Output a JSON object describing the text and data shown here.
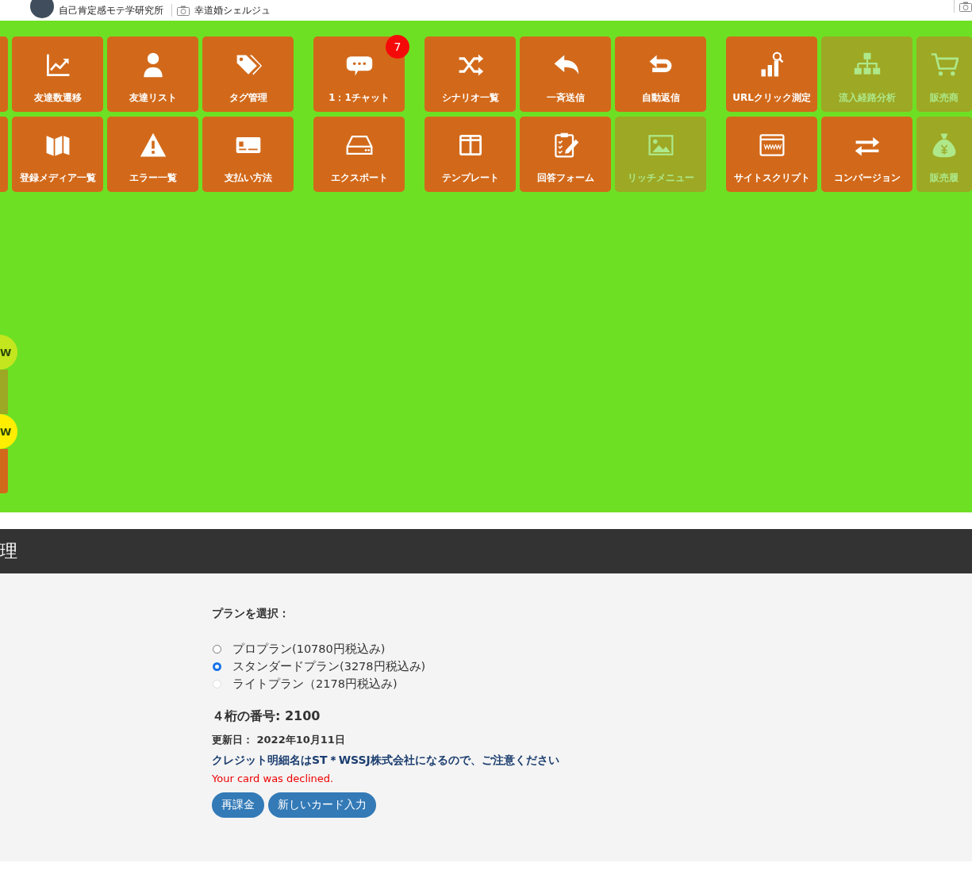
{
  "header": {
    "accounts": [
      {
        "name": "自己肯定感モテ学研究所",
        "kind": "avatar"
      },
      {
        "name": "幸道婚シェルジュ",
        "kind": "camera"
      }
    ]
  },
  "menu": {
    "groups": [
      {
        "tiles": [
          {
            "kind": "blank",
            "disabled": false
          },
          {
            "kind": "tile",
            "label": "友達数遷移",
            "disabled": false
          },
          {
            "kind": "tile",
            "label": "友達リスト",
            "disabled": false
          },
          {
            "kind": "tile",
            "label": "タグ管理",
            "disabled": false
          },
          {
            "kind": "blank",
            "disabled": false
          },
          {
            "kind": "tile",
            "label": "登録メディア一覧",
            "disabled": false
          },
          {
            "kind": "tile",
            "label": "エラー一覧",
            "disabled": false
          },
          {
            "kind": "tile",
            "label": "支払い方法",
            "disabled": false
          }
        ]
      },
      {
        "tiles": [
          {
            "kind": "tile",
            "label": "1：1チャット",
            "disabled": false,
            "badge": "7"
          },
          {
            "kind": "tile",
            "label": "エクスポート",
            "disabled": false
          }
        ]
      },
      {
        "tiles": [
          {
            "kind": "tile",
            "label": "シナリオ一覧",
            "disabled": false
          },
          {
            "kind": "tile",
            "label": "一斉送信",
            "disabled": false
          },
          {
            "kind": "tile",
            "label": "自動返信",
            "disabled": false
          },
          {
            "kind": "tile",
            "label": "テンプレート",
            "disabled": false
          },
          {
            "kind": "tile",
            "label": "回答フォーム",
            "disabled": false
          },
          {
            "kind": "tile",
            "label": "リッチメニュー",
            "disabled": true
          }
        ]
      },
      {
        "tiles": [
          {
            "kind": "tile",
            "label": "URLクリック測定",
            "disabled": false
          },
          {
            "kind": "tile",
            "label": "流入経路分析",
            "disabled": true
          },
          {
            "kind": "tile",
            "label": "販売商",
            "disabled": true
          },
          {
            "kind": "tile",
            "label": "サイトスクリプト",
            "disabled": false
          },
          {
            "kind": "tile",
            "label": "コンバージョン",
            "disabled": false
          },
          {
            "kind": "tile",
            "label": "販売履",
            "disabled": true
          }
        ]
      }
    ]
  },
  "side_badges": [
    {
      "text": "W",
      "color": "#c3e61f"
    },
    {
      "text": "W",
      "color": "#ffee00"
    }
  ],
  "section": {
    "title": "理"
  },
  "form": {
    "plan_label": "プランを選択：",
    "plans": [
      {
        "label": "プロプラン(10780円税込み)",
        "selected": false,
        "disabled": false
      },
      {
        "label": "スタンダードプラン(3278円税込み)",
        "selected": true,
        "disabled": false
      },
      {
        "label": "ライトプラン（2178円税込み)",
        "selected": false,
        "disabled": true
      }
    ],
    "card_digits": "４桁の番号: 2100",
    "updated": "更新日： 2022年10月11日",
    "notice": "クレジット明細名はST＊WSSJ株式会社になるので、ご注意ください",
    "error": "Your card was declined.",
    "buttons": [
      "再課金",
      "新しいカード入力"
    ]
  }
}
